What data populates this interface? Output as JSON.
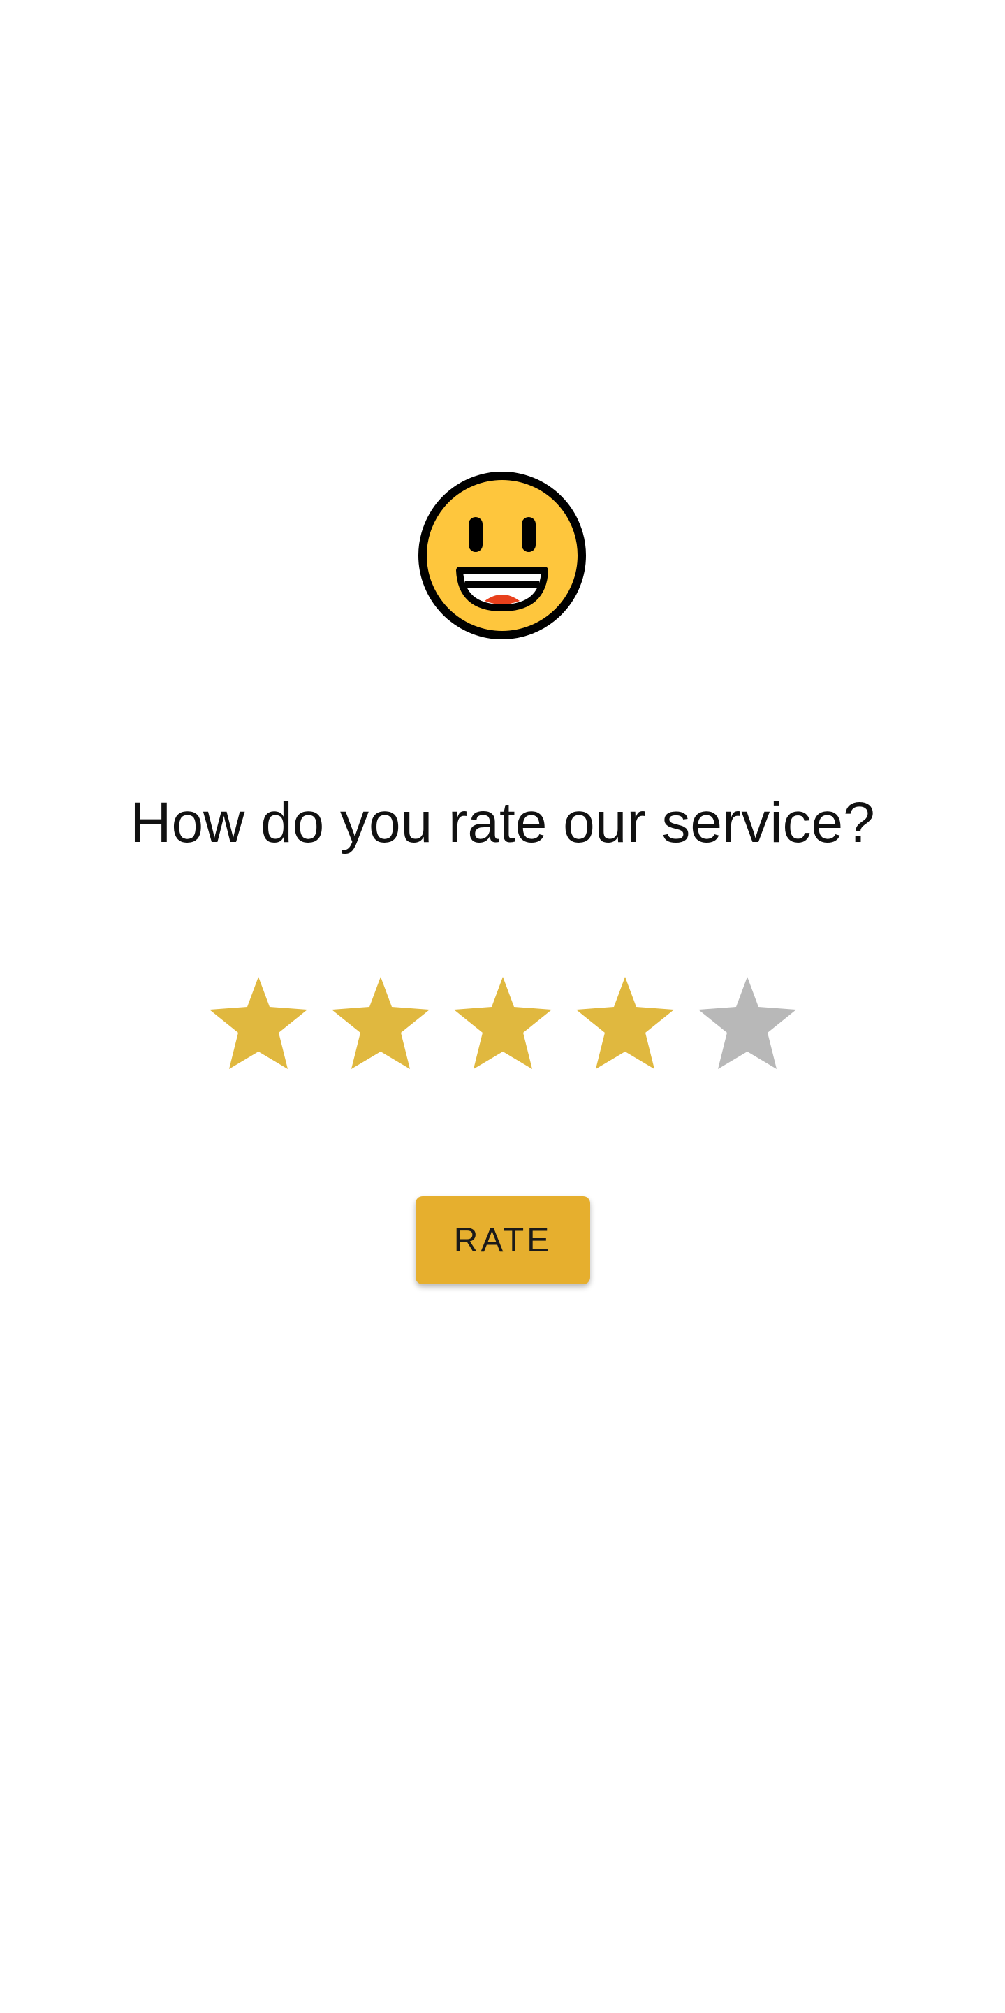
{
  "header": {
    "emoji_icon": "grinning-face-icon"
  },
  "question": {
    "text": "How do you rate our service?"
  },
  "rating": {
    "value": 4,
    "max": 5,
    "filled_color": "#e0b83f",
    "empty_color": "#b8b8b8",
    "star_icon": "star-icon"
  },
  "actions": {
    "rate_label": "RATE",
    "button_color": "#e6af2e"
  }
}
